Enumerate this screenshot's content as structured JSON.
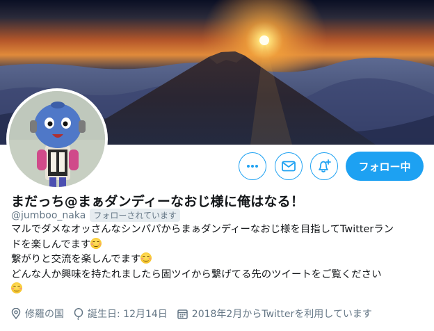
{
  "profile": {
    "display_name": "まだっち@まぁダンディーなおじ様に俺はなる！",
    "handle": "@jumboo_naka",
    "follows_you_badge": "フォローされています",
    "bio_lines": [
      "マルでダメなオッさんなシンパパからまぁダンディーなおじ様を目指してTwitterラン",
      "ドを楽しんでます",
      "繋がりと交流を楽しんでます",
      "どんな人か興味を持たれましたら固ツイから繋げてる先のツイートをご覧ください"
    ],
    "location": "修羅の国",
    "birthday": "誕生日: 12月14日",
    "joined": "2018年2月からTwitterを利用しています"
  },
  "actions": {
    "follow_label": "フォロー中"
  },
  "icons": {
    "more": "more-horizontal-icon",
    "dm": "envelope-icon",
    "notify": "bell-plus-icon",
    "location": "map-pin-icon",
    "birthday": "balloon-icon",
    "joined": "calendar-icon",
    "emoji": "smiling-face-emoji"
  },
  "colors": {
    "accent": "#1da1f2",
    "secondary_text": "#657786",
    "primary_text": "#14171a"
  }
}
